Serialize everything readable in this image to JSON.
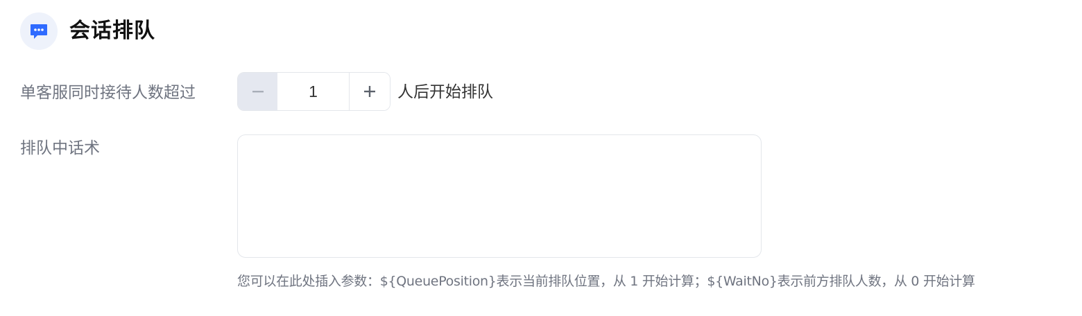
{
  "section": {
    "title": "会话排队",
    "icon": "chat-bubble-icon",
    "icon_color": "#2f6bff"
  },
  "queue_threshold": {
    "label": "单客服同时接待人数超过",
    "value": "1",
    "suffix": "人后开始排队"
  },
  "queue_script": {
    "label": "排队中话术",
    "value": "",
    "hint": "您可以在此处插入参数：${QueuePosition}表示当前排队位置，从 1 开始计算；${WaitNo}表示前方排队人数，从 0 开始计算"
  }
}
